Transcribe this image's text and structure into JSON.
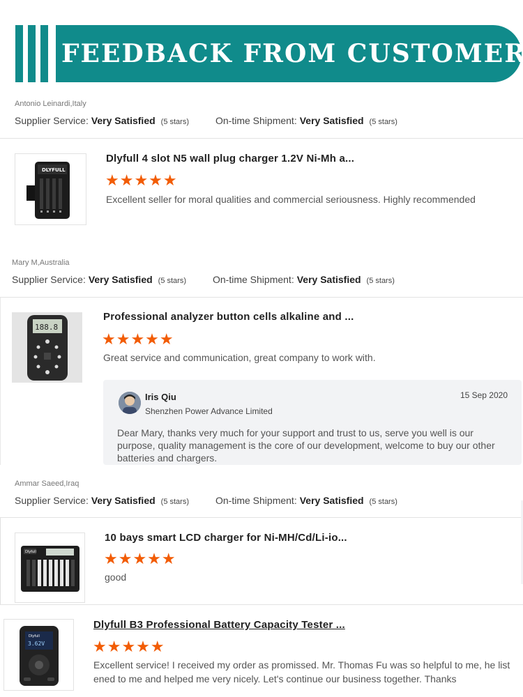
{
  "banner": {
    "title": "FEEDBACK FROM CUSTOMERS"
  },
  "colors": {
    "accent": "#108b8b",
    "stars": "#f25c05"
  },
  "labels": {
    "supplier_service": "Supplier Service:",
    "ontime_shipment": "On-time Shipment:"
  },
  "reviews": [
    {
      "reviewer": "Antonio Leinardi,Italy",
      "supplier_value": "Very Satisfied",
      "supplier_stars": "(5 stars)",
      "shipment_value": "Very Satisfied",
      "shipment_stars": "(5 stars)",
      "product_title": "Dlyfull 4 slot N5 wall plug charger 1.2V Ni-Mh a...",
      "rating": 5,
      "stars": "★★★★★",
      "comment": "Excellent seller for moral qualities and commercial seriousness. Highly recommended",
      "thumb_icon": "battery-charger-4-slot-icon"
    },
    {
      "reviewer": "Mary M,Australia",
      "supplier_value": "Very Satisfied",
      "supplier_stars": "(5 stars)",
      "shipment_value": "Very Satisfied",
      "shipment_stars": "(5 stars)",
      "product_title": "Professional analyzer button cells alkaline and ...",
      "rating": 5,
      "stars": "★★★★★",
      "comment": "Great service and communication, great company to work with.",
      "thumb_icon": "battery-analyzer-icon",
      "reply": {
        "name": "Iris Qiu",
        "company": "Shenzhen Power Advance Limited",
        "date": "15 Sep 2020",
        "text": "Dear Mary,  thanks very much for your support and trust to us, serve you well is our purpose, quality management is the core of our development, welcome to buy our other batteries and chargers."
      }
    },
    {
      "reviewer": "Ammar Saeed,Iraq",
      "supplier_value": "Very Satisfied",
      "supplier_stars": "(5 stars)",
      "shipment_value": "Very Satisfied",
      "shipment_stars": "(5 stars)",
      "product_title": "10 bays smart LCD charger for Ni-MH/Cd/Li-io...",
      "rating": 5,
      "stars": "★★★★★",
      "comment": "good",
      "thumb_icon": "lcd-charger-10-bay-icon"
    },
    {
      "product_title": "Dlyfull B3 Professional Battery Capacity Tester ...",
      "rating": 5,
      "stars": "★★★★★",
      "comment": "Excellent service!  I received my order as promissed.  Mr. Thomas Fu was so helpful to me, he listened to me and helped me very nicely.  Let's continue our business together.  Thanks",
      "thumb_icon": "battery-capacity-tester-icon"
    }
  ]
}
